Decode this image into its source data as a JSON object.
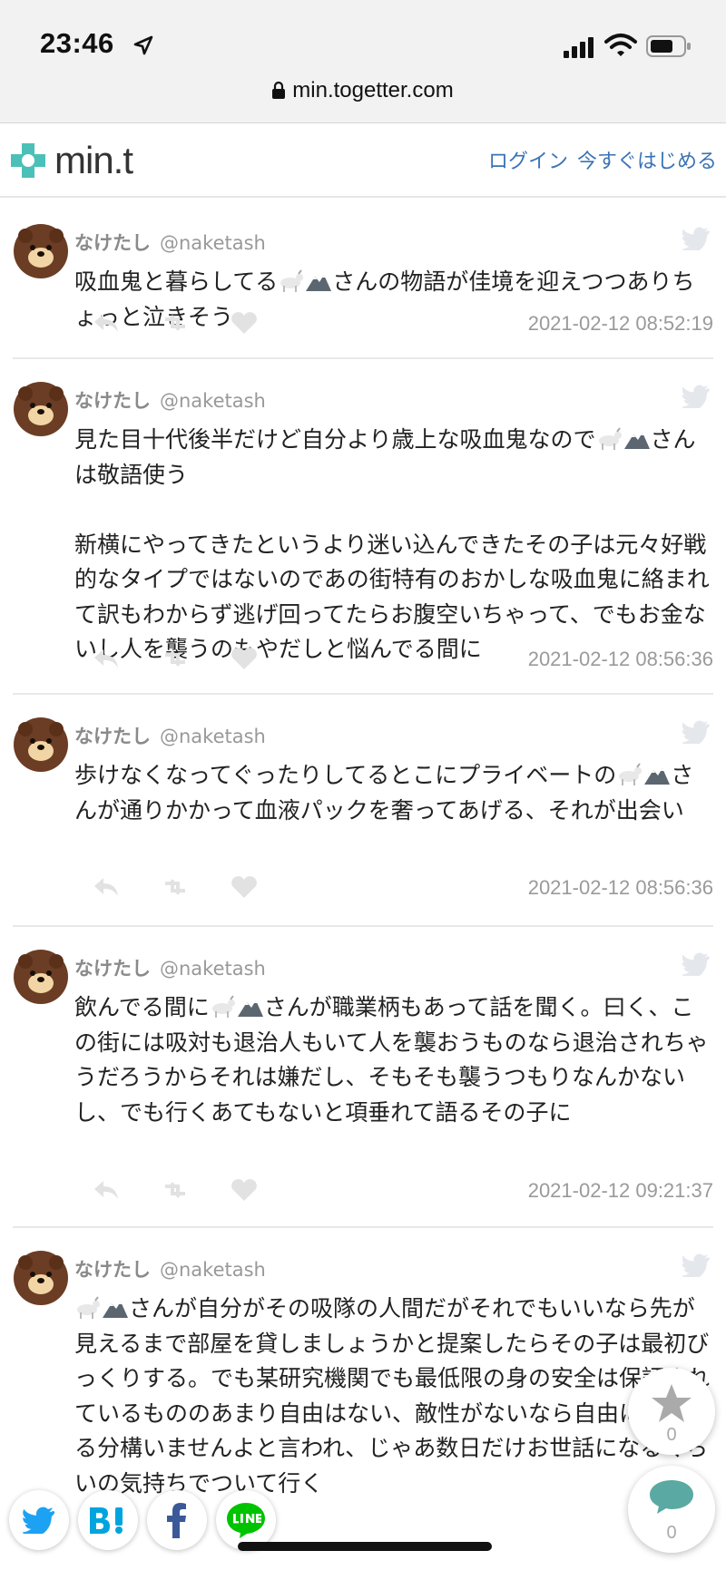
{
  "status": {
    "time": "23:46"
  },
  "browser": {
    "url": "min.togetter.com"
  },
  "header": {
    "logo_text": "min.t",
    "login": "ログイン",
    "start": "今すぐはじめる"
  },
  "tweets": [
    {
      "name": "なけたし",
      "handle": "@naketash",
      "text_a": "吸血鬼と暮らしてる",
      "text_b": "さんの物語が佳境を迎えつつありちょっと泣きそう",
      "date": "2021-02-12 08:52:19"
    },
    {
      "name": "なけたし",
      "handle": "@naketash",
      "text_a": "見た目十代後半だけど自分より歳上な吸血鬼なので",
      "text_b": "さんは敬語使う\n\n新横にやってきたというより迷い込んできたその子は元々好戦的なタイプではないのであの街特有のおかしな吸血鬼に絡まれて訳もわからず逃げ回ってたらお腹空いちゃって、でもお金ないし人を襲うのもやだしと悩んでる間に",
      "date": "2021-02-12 08:56:36"
    },
    {
      "name": "なけたし",
      "handle": "@naketash",
      "text_a": "歩けなくなってぐったりしてるとこにプライベートの",
      "text_b": "さんが通りかかって血液パックを奢ってあげる、それが出会い",
      "date": "2021-02-12 08:56:36"
    },
    {
      "name": "なけたし",
      "handle": "@naketash",
      "text_a": "飲んでる間に",
      "text_b": "さんが職業柄もあって話を聞く。曰く、この街には吸対も退治人もいて人を襲おうものなら退治されちゃうだろうからそれは嫌だし、そもそも襲うつもりなんかないし、でも行くあてもないと項垂れて語るその子に",
      "date": "2021-02-12 09:21:37"
    },
    {
      "name": "なけたし",
      "handle": "@naketash",
      "text_a": "",
      "text_b": "さんが自分がその吸隊の人間だがそれでもいいなら先が見えるまで部屋を貸しましょうかと提案したらその子は最初びっくりする。でも某研究機関でも最低限の身の安全は保証されているもののあまり自由はない、敵性がないなら自由に暮らせる分構いませんよと言われ、じゃあ数日だけお世話になるくらいの気持ちでついて行く",
      "date": ""
    }
  ],
  "floating": {
    "favorite_count": "0",
    "comment_count": "0"
  },
  "colors": {
    "link": "#3a73b5",
    "logo": "#4bc0b8",
    "twitter": "#1da1f2",
    "hatena": "#00a4de",
    "facebook": "#3b5998",
    "line": "#00c300",
    "comment": "#5aa9a3"
  }
}
